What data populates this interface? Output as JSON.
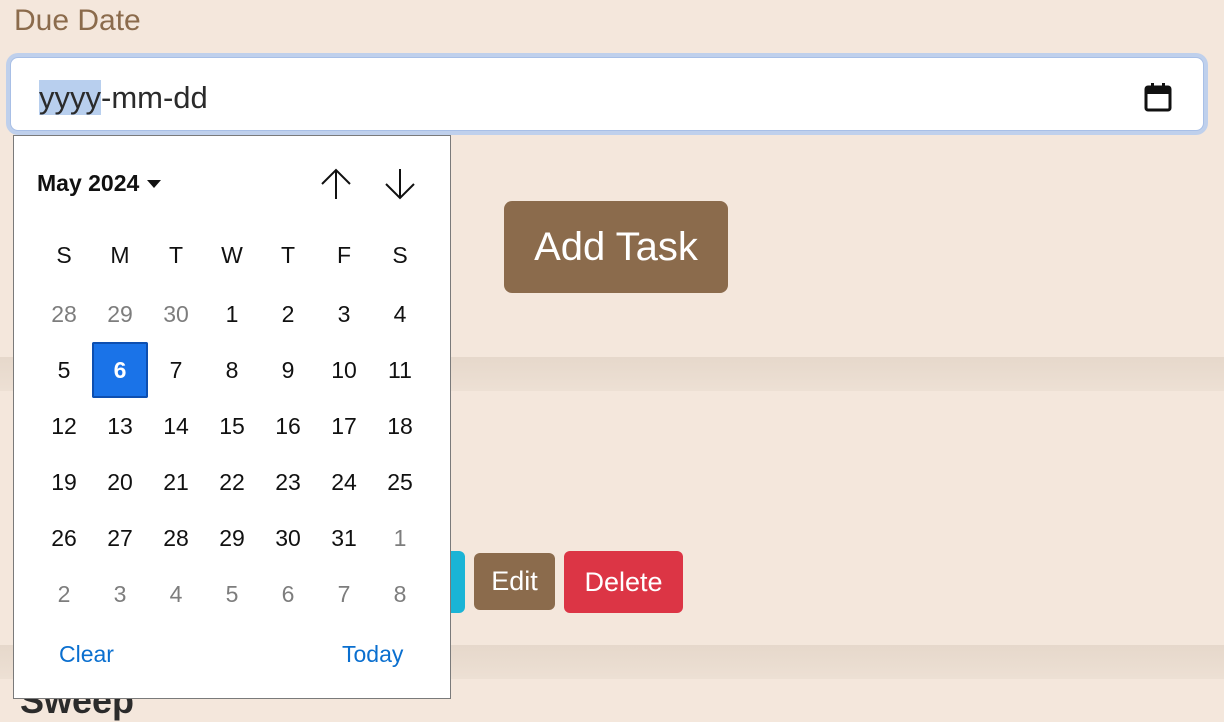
{
  "form": {
    "due_date_label": "Due Date",
    "date_input": {
      "segment_year": "yyyy",
      "rest": "-mm-dd"
    },
    "add_task_label": "Add Task"
  },
  "task": {
    "edit_label": "Edit",
    "delete_label": "Delete",
    "next_title_partial": "Sweep"
  },
  "datepicker": {
    "month_label": "May 2024",
    "weekdays": [
      "S",
      "M",
      "T",
      "W",
      "T",
      "F",
      "S"
    ],
    "weeks": [
      [
        {
          "d": "28",
          "m": true
        },
        {
          "d": "29",
          "m": true
        },
        {
          "d": "30",
          "m": true
        },
        {
          "d": "1"
        },
        {
          "d": "2"
        },
        {
          "d": "3"
        },
        {
          "d": "4"
        }
      ],
      [
        {
          "d": "5"
        },
        {
          "d": "6",
          "sel": true
        },
        {
          "d": "7"
        },
        {
          "d": "8"
        },
        {
          "d": "9"
        },
        {
          "d": "10"
        },
        {
          "d": "11"
        }
      ],
      [
        {
          "d": "12"
        },
        {
          "d": "13"
        },
        {
          "d": "14"
        },
        {
          "d": "15"
        },
        {
          "d": "16"
        },
        {
          "d": "17"
        },
        {
          "d": "18"
        }
      ],
      [
        {
          "d": "19"
        },
        {
          "d": "20"
        },
        {
          "d": "21"
        },
        {
          "d": "22"
        },
        {
          "d": "23"
        },
        {
          "d": "24"
        },
        {
          "d": "25"
        }
      ],
      [
        {
          "d": "26"
        },
        {
          "d": "27"
        },
        {
          "d": "28"
        },
        {
          "d": "29"
        },
        {
          "d": "30"
        },
        {
          "d": "31"
        },
        {
          "d": "1",
          "m": true
        }
      ],
      [
        {
          "d": "2",
          "m": true
        },
        {
          "d": "3",
          "m": true
        },
        {
          "d": "4",
          "m": true
        },
        {
          "d": "5",
          "m": true
        },
        {
          "d": "6",
          "m": true
        },
        {
          "d": "7",
          "m": true
        },
        {
          "d": "8",
          "m": true
        }
      ]
    ],
    "clear_label": "Clear",
    "today_label": "Today"
  },
  "colors": {
    "page_bg": "#f4e7dc",
    "brand_brown": "#8b6b4c",
    "danger": "#dc3545",
    "info": "#1ab4d6",
    "selected_day": "#1a73e8",
    "link": "#0a6fcf"
  }
}
